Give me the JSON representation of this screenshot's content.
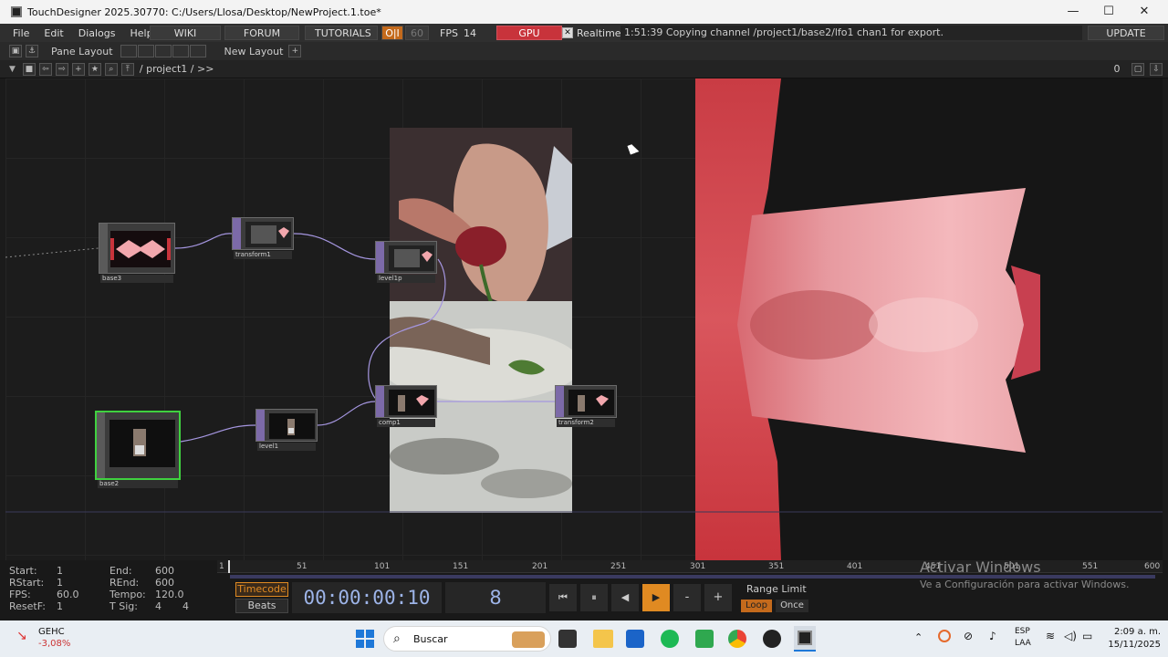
{
  "window": {
    "title": "TouchDesigner 2025.30770: C:/Users/Llosa/Desktop/NewProject.1.toe*",
    "minimize": "—",
    "maximize": "☐",
    "close": "✕"
  },
  "menubar": {
    "menus": [
      "File",
      "Edit",
      "Dialogs",
      "Help"
    ],
    "wiki": "WIKI",
    "forum": "FORUM",
    "tutorials": "TUTORIALS",
    "oi": "O|I",
    "fps_target": "60",
    "fps_label": "FPS",
    "fps_value": "14",
    "gpu": "GPU",
    "realtime": "Realtime",
    "status": "1:51:39 Copying channel /project1/base2/lfo1 chan1 for export.",
    "update": "UPDATE"
  },
  "toolbar": {
    "pane_layout": "Pane Layout",
    "new_layout": "New Layout",
    "plus": "+"
  },
  "pathbar": {
    "path": "/ project1 / >>",
    "counter": "0"
  },
  "nodes": [
    {
      "id": "base3",
      "label": "base3"
    },
    {
      "id": "transform1",
      "label": "transform1"
    },
    {
      "id": "level1p",
      "label": "level1p"
    },
    {
      "id": "base2",
      "label": "base2"
    },
    {
      "id": "level1",
      "label": "level1"
    },
    {
      "id": "comp1",
      "label": "comp1"
    },
    {
      "id": "transform2",
      "label": "transform2"
    }
  ],
  "timeline": {
    "start_label": "Start:",
    "start": "1",
    "rstart_label": "RStart:",
    "rstart": "1",
    "fps_label": "FPS:",
    "fps": "60.0",
    "resetf_label": "ResetF:",
    "resetf": "1",
    "end_label": "End:",
    "end": "600",
    "rend_label": "REnd:",
    "rend": "600",
    "tempo_label": "Tempo:",
    "tempo": "120.0",
    "tsig_label": "T Sig:",
    "tsig_a": "4",
    "tsig_b": "4",
    "ticks": [
      "1",
      "51",
      "101",
      "151",
      "201",
      "251",
      "301",
      "351",
      "401",
      "451",
      "501",
      "551",
      "600"
    ],
    "timecode_btn": "Timecode",
    "beats_btn": "Beats",
    "timecode": "00:00:00:10",
    "frame": "8",
    "minus": "-",
    "plus": "+",
    "range_limit": "Range Limit",
    "loop": "Loop",
    "once": "Once",
    "activate_title": "Activar Windows",
    "activate_sub": "Ve a Configuración para activar Windows."
  },
  "taskbar": {
    "stock_name": "GEHC",
    "stock_change": "-3,08%",
    "search": "Buscar",
    "lang1": "ESP",
    "lang2": "LAA",
    "time": "2:09 a. m.",
    "date": "15/11/2025"
  },
  "colors": {
    "accent_red": "#c8333b",
    "node_purple": "#7c6aa8",
    "selected_green": "#3fd13f",
    "play_orange": "#e08a22",
    "pink": "#f2a7ad"
  }
}
